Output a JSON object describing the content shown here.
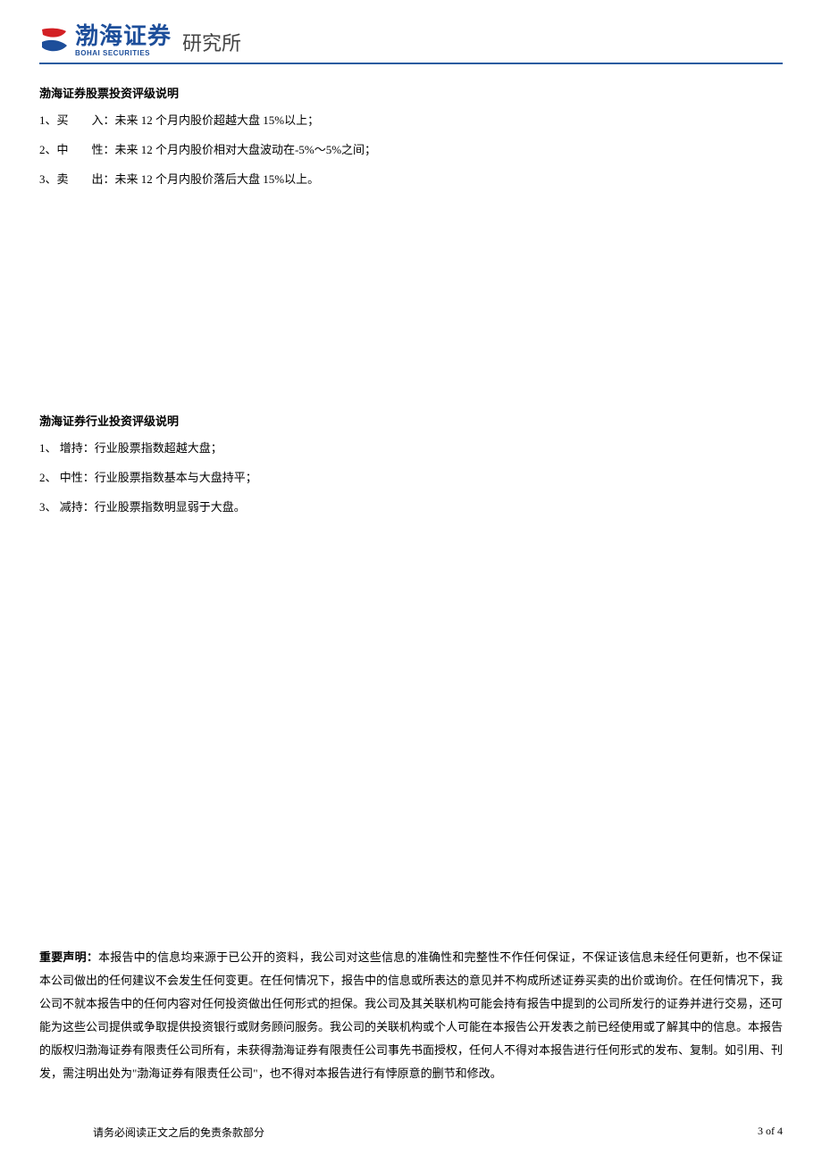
{
  "header": {
    "logo_cn": "渤海证券",
    "logo_en": "BOHAI SECURITIES",
    "unit": "研究所"
  },
  "section1": {
    "title": "渤海证券股票投资评级说明",
    "items": [
      {
        "index": "1、",
        "label": "买　　入：",
        "desc": "未来 12 个月内股价超越大盘 15%以上；"
      },
      {
        "index": "2、",
        "label": "中　　性：",
        "desc": "未来 12 个月内股价相对大盘波动在-5%～5%之间；"
      },
      {
        "index": "3、",
        "label": "卖　　出：",
        "desc": "未来 12 个月内股价落后大盘 15%以上。"
      }
    ]
  },
  "section2": {
    "title": "渤海证券行业投资评级说明",
    "items": [
      {
        "index": "1、",
        "label": " 增持：",
        "desc": "行业股票指数超越大盘；"
      },
      {
        "index": "2、",
        "label": " 中性：",
        "desc": "行业股票指数基本与大盘持平；"
      },
      {
        "index": "3、",
        "label": " 减持：",
        "desc": "行业股票指数明显弱于大盘。"
      }
    ]
  },
  "disclaimer": {
    "title": "重要声明：",
    "body": "本报告中的信息均来源于已公开的资料，我公司对这些信息的准确性和完整性不作任何保证，不保证该信息未经任何更新，也不保证本公司做出的任何建议不会发生任何变更。在任何情况下，报告中的信息或所表达的意见并不构成所述证券买卖的出价或询价。在任何情况下，我公司不就本报告中的任何内容对任何投资做出任何形式的担保。我公司及其关联机构可能会持有报告中提到的公司所发行的证券并进行交易，还可能为这些公司提供或争取提供投资银行或财务顾问服务。我公司的关联机构或个人可能在本报告公开发表之前已经使用或了解其中的信息。本报告的版权归渤海证券有限责任公司所有，未获得渤海证券有限责任公司事先书面授权，任何人不得对本报告进行任何形式的发布、复制。如引用、刊发，需注明出处为\"渤海证券有限责任公司\"，也不得对本报告进行有悖原意的删节和修改。"
  },
  "footer": {
    "left": "请务必阅读正文之后的免责条款部分",
    "right": "3 of 4"
  }
}
